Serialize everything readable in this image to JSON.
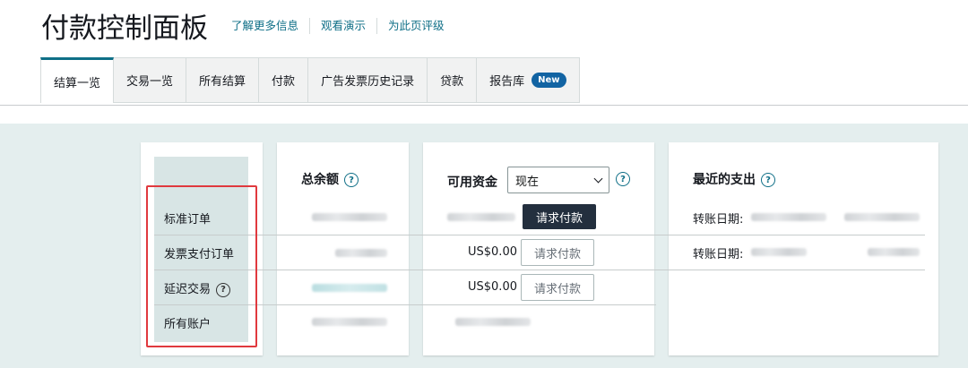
{
  "header": {
    "title": "付款控制面板",
    "links": [
      "了解更多信息",
      "观看演示",
      "为此页评级"
    ]
  },
  "tabs": [
    {
      "label": "结算一览"
    },
    {
      "label": "交易一览"
    },
    {
      "label": "所有结算"
    },
    {
      "label": "付款"
    },
    {
      "label": "广告发票历史记录"
    },
    {
      "label": "贷款"
    },
    {
      "label": "报告库",
      "badge": "New"
    }
  ],
  "rows": [
    "标准订单",
    "发票支付订单",
    "延迟交易",
    "所有账户"
  ],
  "total_balance": {
    "title": "总余额"
  },
  "available_funds": {
    "title": "可用资金",
    "select_value": "现在",
    "request_payment_primary": "请求付款",
    "amounts": [
      "US$0.00",
      "US$0.00"
    ],
    "request_payment": "请求付款"
  },
  "recent_payouts": {
    "title": "最近的支出",
    "transfer_date_label": "转账日期:"
  },
  "icons": {
    "help": "help-circle-icon",
    "dropdown": "chevron-down-icon"
  },
  "colors": {
    "accent": "#0f6f87",
    "highlight": "#e0393e",
    "badge": "#1264a3"
  }
}
